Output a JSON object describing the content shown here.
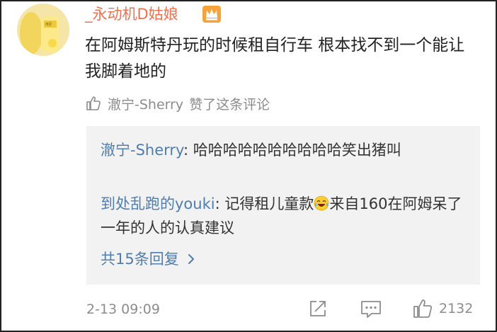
{
  "comment": {
    "username": "_永动机D姑娘",
    "badge_icon": "crown-icon",
    "text": "在阿姆斯特丹玩的时候租自行车 根本找不到一个能让我脚着地的",
    "liked_by": "澈宁-Sherry",
    "liked_by_suffix": "赞了这条评论",
    "timestamp": "2-13 09:09",
    "like_count": "2132"
  },
  "replies": [
    {
      "author": "澈宁-Sherry",
      "separator": ": ",
      "text": "哈哈哈哈哈哈哈哈哈哈笑出猪叫"
    },
    {
      "author": "到处乱跑的youki",
      "separator": ": ",
      "text_before": "记得租儿童款",
      "emoji": "laughing-crying-emoji",
      "text_after": "来自160在阿姆呆了一年的人的认真建议"
    }
  ],
  "more_replies_label": "共15条回复",
  "colors": {
    "username": "#eb7350",
    "link": "#507daf",
    "muted": "#8c8c8c",
    "reply_bg": "#f2f2f2"
  }
}
